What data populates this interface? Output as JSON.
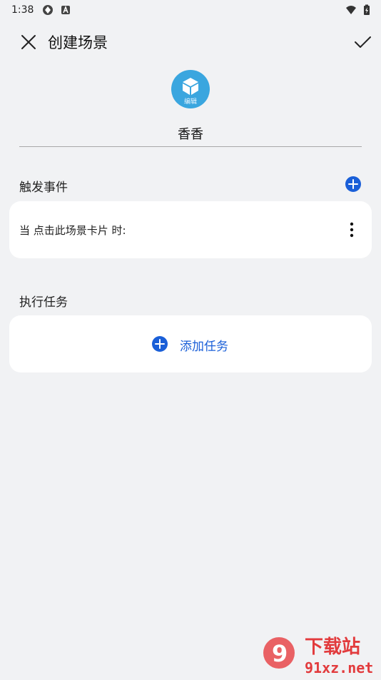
{
  "status_bar": {
    "time": "1:38"
  },
  "header": {
    "title": "创建场景"
  },
  "avatar": {
    "caption": "编辑"
  },
  "scene": {
    "name": "香香"
  },
  "trigger_section": {
    "label": "触发事件",
    "items": [
      {
        "text": "当 点击此场景卡片 时:"
      }
    ]
  },
  "task_section": {
    "label": "执行任务",
    "add_label": "添加任务"
  },
  "watermark": {
    "text_top": "下载站",
    "text_bottom": "91xz.net",
    "logo_text": "9"
  },
  "colors": {
    "accent": "#1a5fd8",
    "background": "#f1f2f4",
    "card": "#ffffff",
    "avatar": "#3aa6df"
  }
}
